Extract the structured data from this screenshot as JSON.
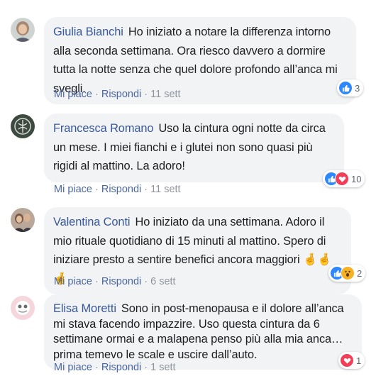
{
  "comments": [
    {
      "name": "Giulia Bianchi",
      "text": "Ho iniziato a notare la differenza intorno alla seconda settimana. Ora riesco davvero a dormire tutta la notte senza che quel dolore profondo all’anca mi svegli.",
      "like": "Mi piace",
      "reply": "Rispondi",
      "time": "11 sett",
      "reactions": [
        "like-icon"
      ],
      "reaction_count": "3"
    },
    {
      "name": "Francesca Romano",
      "text": "Uso la cintura ogni notte da circa un mese. I miei fianchi e i glutei non sono quasi più rigidi al mattino. La adoro!",
      "like": "Mi piace",
      "reply": "Rispondi",
      "time": "11 sett",
      "reactions": [
        "like-icon",
        "love-icon"
      ],
      "reaction_count": "10"
    },
    {
      "name": "Valentina Conti",
      "text": "Ho iniziato da una settimana. Adoro il mio rituale quotidiano di 15 minuti al mattino. Spero di iniziare presto a sentire benefici ancora maggiori 🤞🤞🤞",
      "like": "Mi piace",
      "reply": "Rispondi",
      "time": "6 sett",
      "reactions": [
        "like-icon",
        "wow-icon"
      ],
      "reaction_count": "2"
    },
    {
      "name": "Elisa Moretti",
      "text": "Sono in post-menopausa e il dolore all’anca mi stava facendo impazzire. Uso questa cintura da 6 settimane ormai e a malapena penso più alla mia anca… prima temevo le scale e uscire dall’auto.",
      "like": "Mi piace",
      "reply": "Rispondi",
      "time": "1 sett",
      "reactions": [
        "love-icon"
      ],
      "reaction_count": "1"
    }
  ],
  "colors": {
    "link": "#385898",
    "bubble": "#f2f3f5",
    "like_blue": "#2d88ff",
    "love_red": "#f33e58",
    "wow_yellow": "#f7b125"
  }
}
